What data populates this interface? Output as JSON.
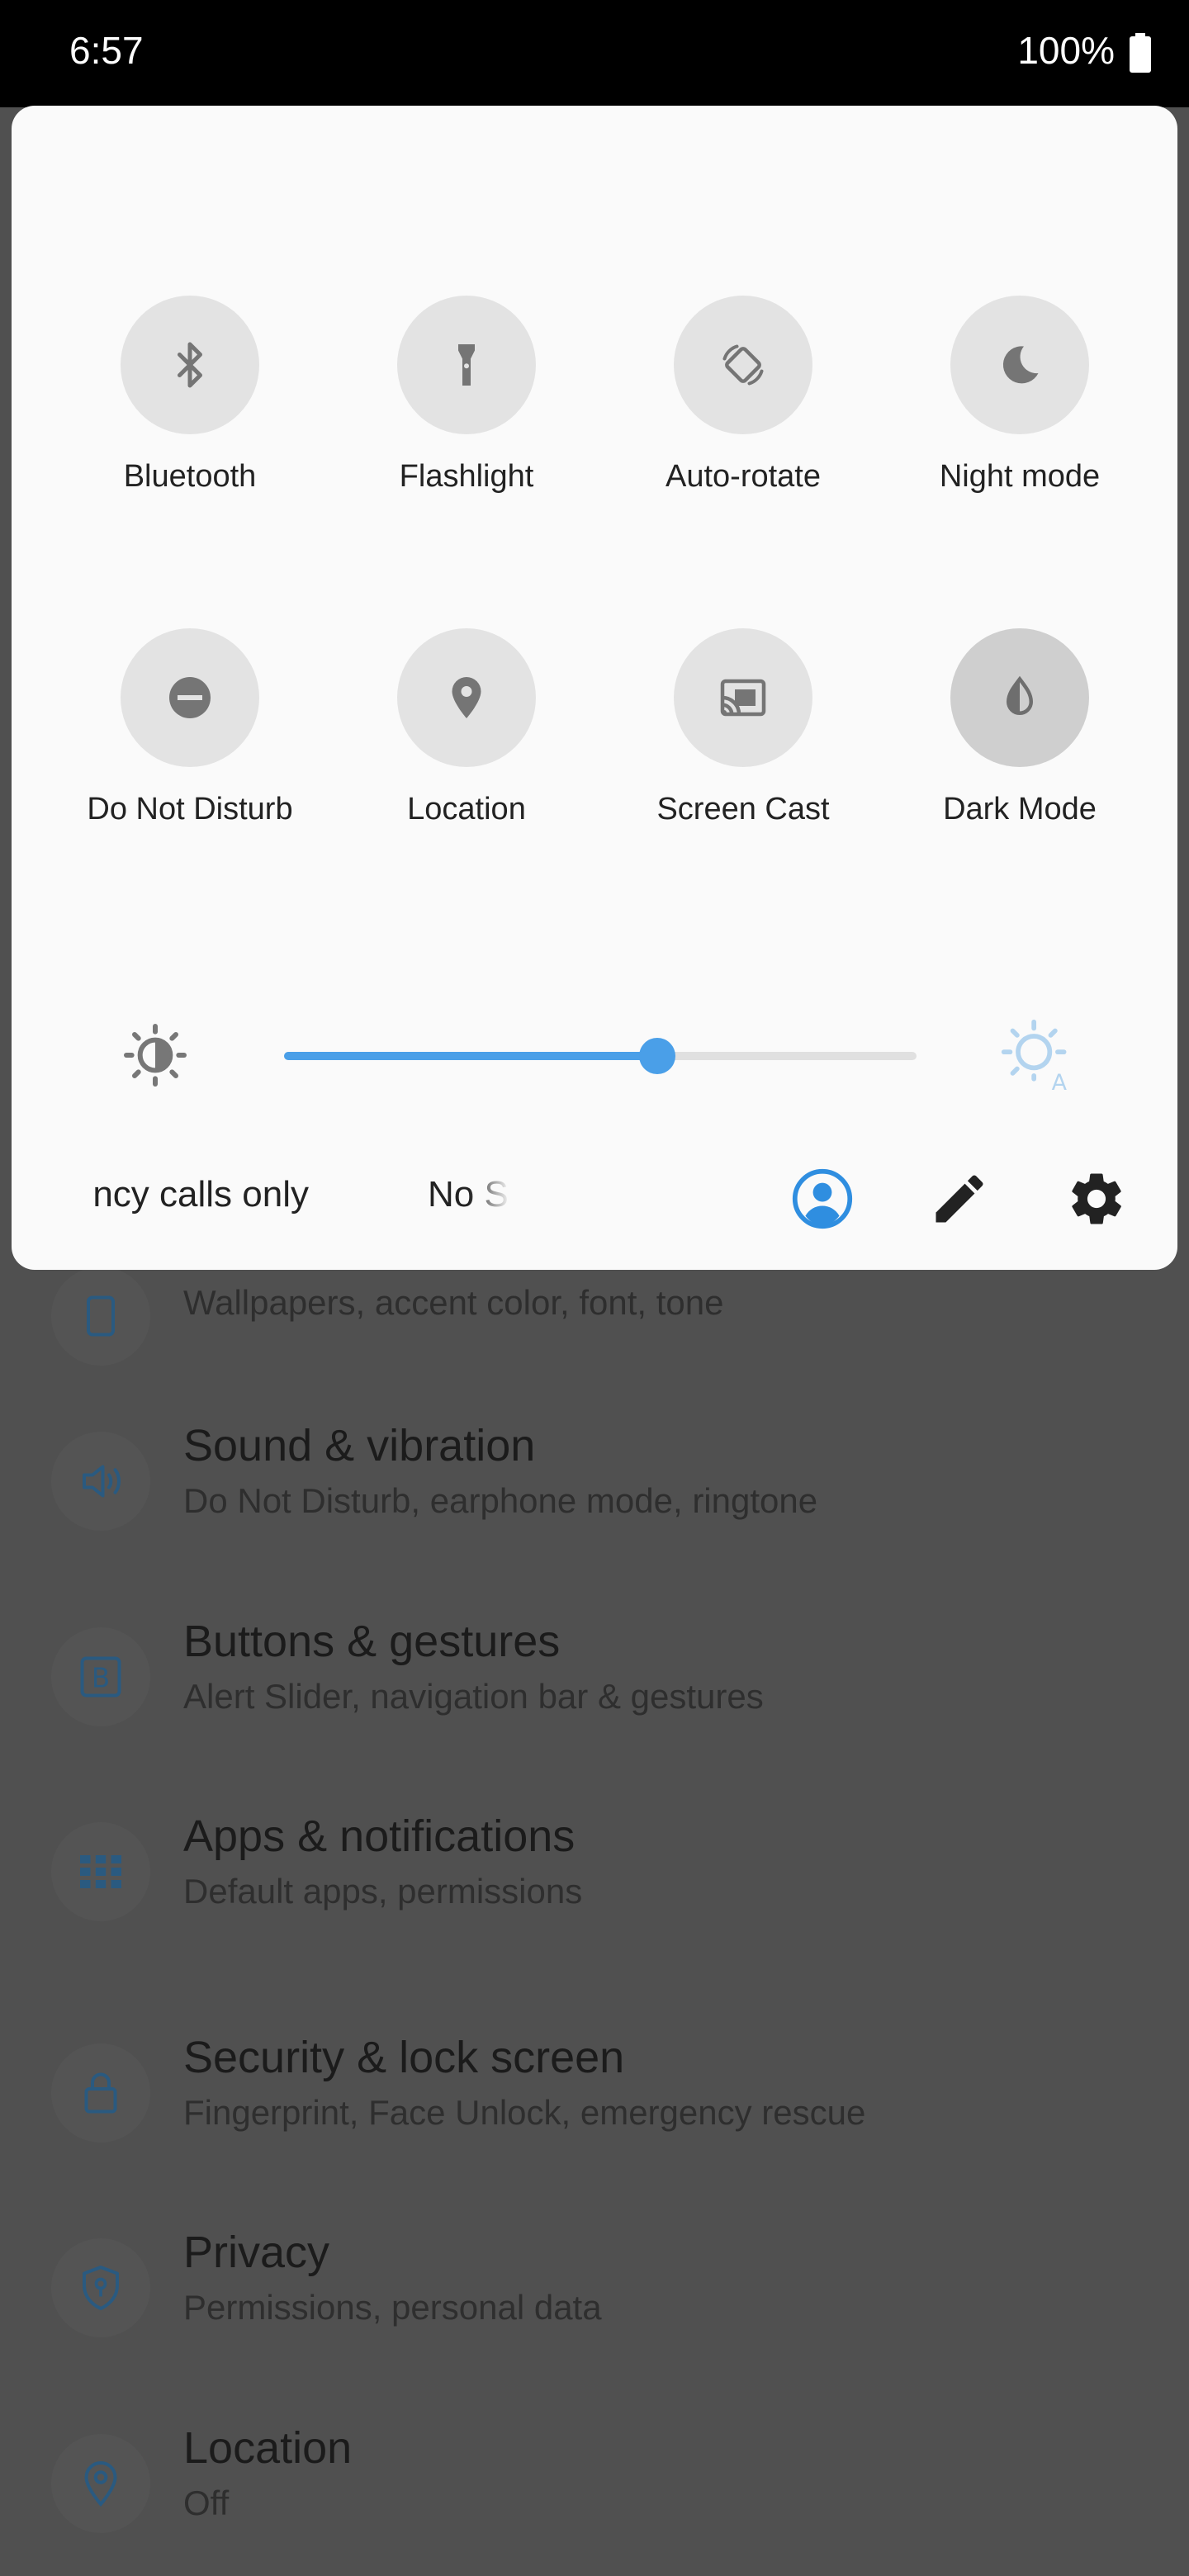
{
  "status_bar": {
    "time": "6:57",
    "battery": "100%"
  },
  "quick_settings": {
    "tiles": [
      {
        "label": "Bluetooth",
        "icon": "bluetooth-icon",
        "active": false
      },
      {
        "label": "Flashlight",
        "icon": "flashlight-icon",
        "active": false
      },
      {
        "label": "Auto-rotate",
        "icon": "auto-rotate-icon",
        "active": false
      },
      {
        "label": "Night mode",
        "icon": "night-mode-icon",
        "active": false
      },
      {
        "label": "Do Not Disturb",
        "icon": "do-not-disturb-icon",
        "active": false
      },
      {
        "label": "Location",
        "icon": "location-icon",
        "active": false
      },
      {
        "label": "Screen Cast",
        "icon": "screen-cast-icon",
        "active": false
      },
      {
        "label": "Dark Mode",
        "icon": "dark-mode-icon",
        "active": true
      }
    ],
    "brightness": {
      "level_fraction": 0.59
    },
    "footer": {
      "carrier_text": "ncy calls only",
      "carrier_text_2": "No S"
    }
  },
  "settings_list": [
    {
      "title": "",
      "subtitle": "Wallpapers, accent color, font, tone",
      "icon": "display-icon"
    },
    {
      "title": "Sound & vibration",
      "subtitle": "Do Not Disturb, earphone mode, ringtone",
      "icon": "speaker-icon"
    },
    {
      "title": "Buttons & gestures",
      "subtitle": "Alert Slider, navigation bar & gestures",
      "icon": "button-b-icon"
    },
    {
      "title": "Apps & notifications",
      "subtitle": "Default apps, permissions",
      "icon": "apps-grid-icon"
    },
    {
      "title": "Security & lock screen",
      "subtitle": "Fingerprint, Face Unlock, emergency rescue",
      "icon": "lock-icon"
    },
    {
      "title": "Privacy",
      "subtitle": "Permissions, personal data",
      "icon": "privacy-shield-icon"
    },
    {
      "title": "Location",
      "subtitle": "Off",
      "icon": "location-pin-icon"
    }
  ],
  "colors": {
    "accent": "#4a9fe8",
    "panel_bg": "#fafafa",
    "scrim": "#505050"
  }
}
